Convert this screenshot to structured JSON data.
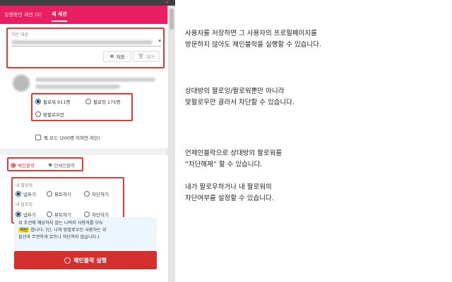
{
  "tabs": [
    {
      "label": "실행중인 세션 (0)"
    },
    {
      "label": "새 세션"
    }
  ],
  "target": {
    "label": "차단 대상",
    "save_label": "저장",
    "delete_label": "제거"
  },
  "relation": {
    "follower_option": "팔로워 911명",
    "following_option": "팔로잉 175명",
    "mutual_option": "맞팔로우만"
  },
  "quick_mode": {
    "label": "퀵 모드 (200명 이하만 차단)"
  },
  "mode_tabs": {
    "chainblock": "체인블락",
    "unchainblock": "언체인블락"
  },
  "my_follower": {
    "label": "내 팔로워",
    "options": [
      "냅두기",
      "뮤트하기",
      "차단하기"
    ]
  },
  "my_following": {
    "label": "내 팔로잉",
    "options": [
      "냅두기",
      "뮤트하기",
      "차단하기"
    ]
  },
  "info": {
    "line1": "위 조건에 해당하지 않는 나머지 사용자를 모두",
    "highlight": "차단",
    "line2_rest": "합니다. (단, 나와 맞팔로우인 사용자는 위",
    "line3": "옵션과 무관하게 뮤트나 차단하지 않습니다.)"
  },
  "run_label": "체인블락 실행",
  "descriptions": {
    "d1": [
      "사용자를 저장하면 그 사용자의 프로필페이지를",
      "방문하지 않아도 체인블락을 실행할 수 있습니다."
    ],
    "d2": [
      "상대방의 팔로잉/팔로워뿐만 아니라",
      "맞팔로우만 골라서 차단할 수 있습니다."
    ],
    "d3": [
      "언체인블락으로 상대방의 팔로워를",
      "“차단해제” 할 수 있습니다."
    ],
    "d4": [
      "내가 팔로우하거나 내 팔로워의",
      "차단여부를 설정할 수 있습니다."
    ]
  },
  "colors": {
    "accent": "#e91e63",
    "annotation": "#e53935",
    "run_button": "#d32f2f"
  }
}
